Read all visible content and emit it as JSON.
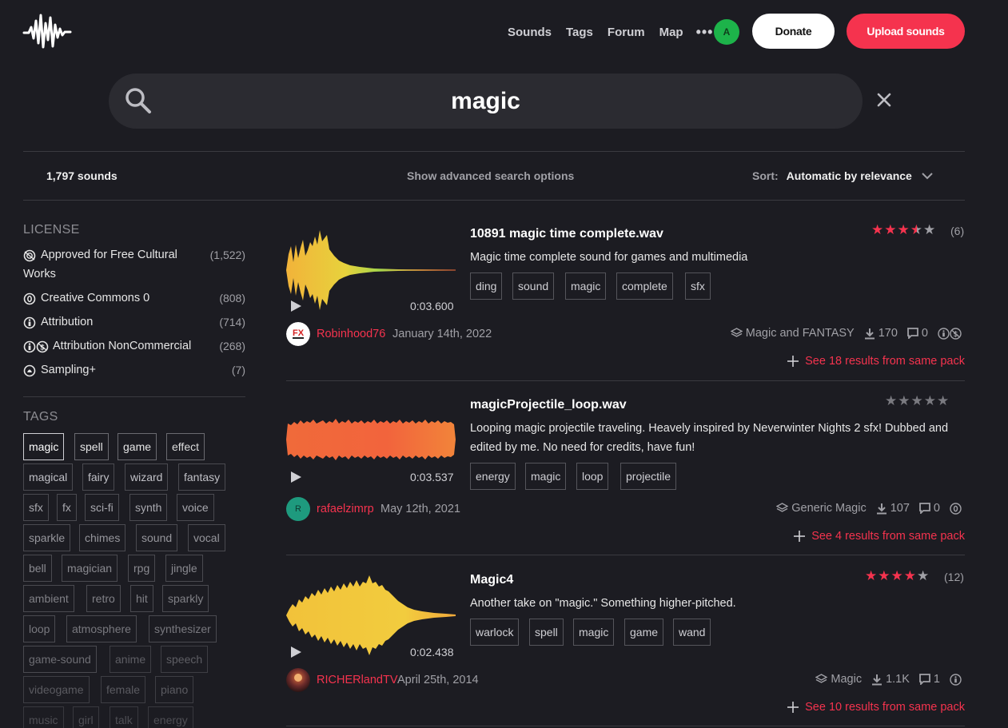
{
  "nav": {
    "links": [
      "Sounds",
      "Tags",
      "Forum",
      "Map"
    ],
    "more": "•••",
    "user_initial": "A",
    "donate_label": "Donate",
    "upload_label": "Upload sounds"
  },
  "search": {
    "value": "magic"
  },
  "results_header": {
    "count": "1,797 sounds",
    "advanced": "Show advanced search options",
    "sort_label": "Sort:",
    "sort_value": "Automatic by relevance"
  },
  "sidebar": {
    "license_heading": "LICENSE",
    "licenses": [
      {
        "label": "Approved for Free Cultural Works",
        "label_line1": "Approved for Free Cultural",
        "label_line2": "Works",
        "count": "(1,522)"
      },
      {
        "label": "Creative Commons 0",
        "count": "(808)"
      },
      {
        "label": "Attribution",
        "count": "(714)"
      },
      {
        "label": "Attribution NonCommercial",
        "count": "(268)"
      },
      {
        "label": "Sampling+",
        "count": "(7)"
      }
    ],
    "tags_heading": "TAGS",
    "tags": [
      "magic",
      "spell",
      "game",
      "effect",
      "magical",
      "fairy",
      "wizard",
      "fantasy",
      "sfx",
      "fx",
      "sci-fi",
      "synth",
      "voice",
      "sparkle",
      "chimes",
      "sound",
      "vocal",
      "bell",
      "magician",
      "rpg",
      "jingle",
      "ambient",
      "retro",
      "hit",
      "sparkly",
      "loop",
      "atmosphere",
      "synthesizer",
      "game-sound",
      "anime",
      "speech",
      "videogame",
      "female",
      "piano",
      "music",
      "girl",
      "talk",
      "energy"
    ]
  },
  "results": [
    {
      "title": "10891 magic time complete.wav",
      "description": "Magic time complete sound for games and multimedia",
      "tags": [
        "ding",
        "sound",
        "magic",
        "complete",
        "sfx"
      ],
      "duration": "0:03.600",
      "rating": 3.5,
      "ratings_count": "(6)",
      "user": "Robinhood76",
      "date": "January 14th, 2022",
      "pack": "Magic and FANTASY",
      "downloads": "170",
      "comments": "0",
      "pack_link": "See 18 results from same pack"
    },
    {
      "title": "magicProjectile_loop.wav",
      "description": "Looping magic projectile traveling. Heavely inspired by Neverwinter Nights 2 sfx! Dubbed and edited by me. No need for credits, have fun!",
      "tags": [
        "energy",
        "magic",
        "loop",
        "projectile"
      ],
      "duration": "0:03.537",
      "rating": 0,
      "ratings_count": "",
      "user": "rafaelzimrp",
      "user_initial": "R",
      "date": "May 12th, 2021",
      "pack": "Generic Magic",
      "downloads": "107",
      "comments": "0",
      "pack_link": "See 4 results from same pack"
    },
    {
      "title": "Magic4",
      "description": "Another take on \"magic.\" Something higher-pitched.",
      "tags": [
        "warlock",
        "spell",
        "magic",
        "game",
        "wand"
      ],
      "duration": "0:02.438",
      "rating": 4,
      "ratings_count": "(12)",
      "user": "RICHERlandTV",
      "date": "April 25th, 2014",
      "pack": "Magic",
      "downloads": "1.1K",
      "comments": "1",
      "pack_link": "See 10 results from same pack"
    }
  ],
  "colors": {
    "background": "#1c1c22",
    "accent": "#f5334e",
    "green_avatar": "#1db34a",
    "teal_avatar": "#1e9a7e"
  }
}
